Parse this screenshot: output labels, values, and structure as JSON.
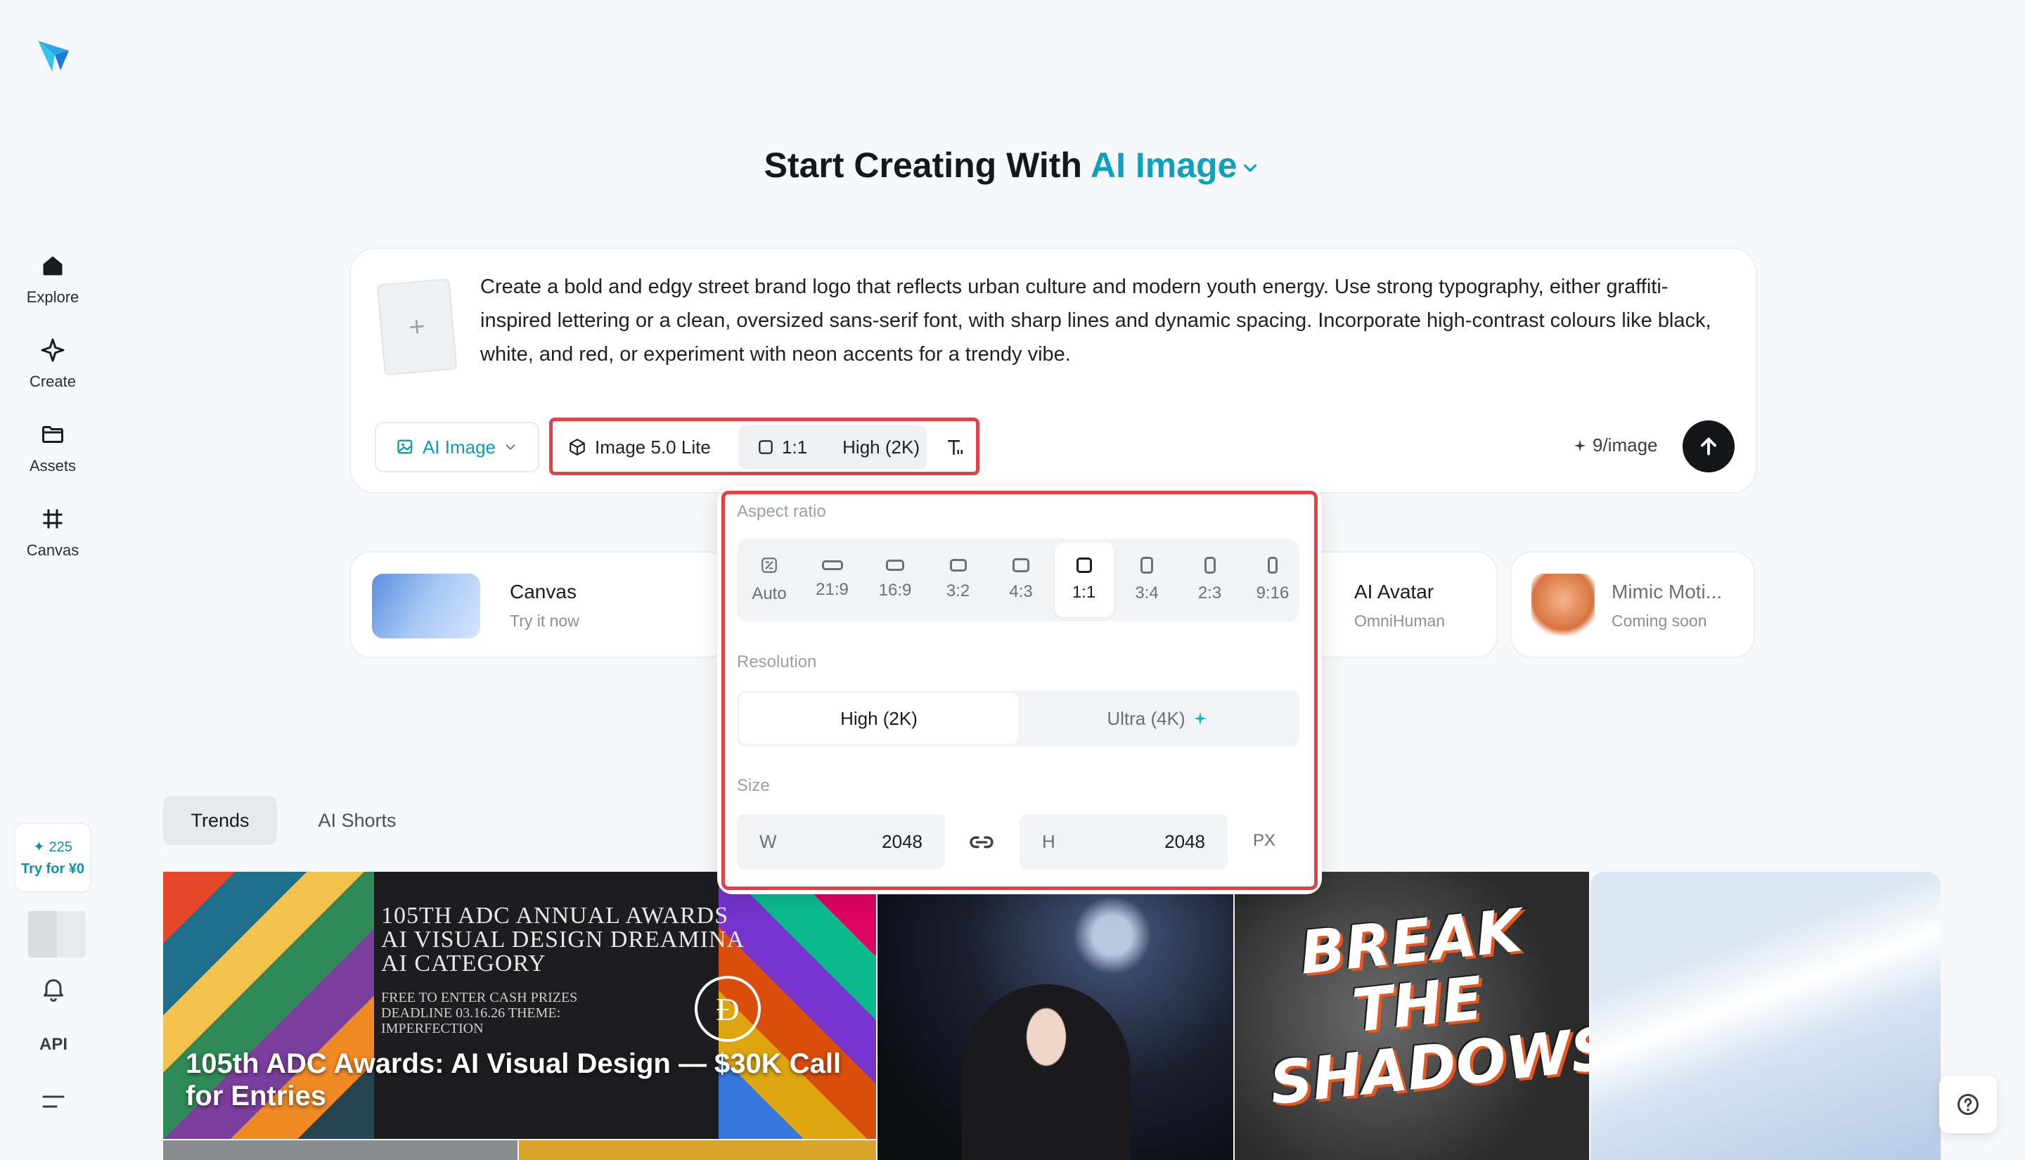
{
  "sidebar": {
    "items": [
      {
        "label": "Explore",
        "icon": "home-icon"
      },
      {
        "label": "Create",
        "icon": "sparkle-outline-icon"
      },
      {
        "label": "Assets",
        "icon": "folder-icon"
      },
      {
        "label": "Canvas",
        "icon": "frame-icon"
      }
    ],
    "credits": {
      "amount": "✦ 225",
      "cta": "Try for ¥0"
    },
    "api_label": "API"
  },
  "headline": {
    "prefix": "Start Creating With ",
    "mode": "AI Image"
  },
  "prompt": {
    "text": "Create a bold and edgy street brand logo that reflects urban culture and modern youth energy. Use strong typography, either graffiti-inspired lettering or a clean, oversized sans-serif font, with sharp lines and dynamic spacing. Incorporate high-contrast colours like black, white, and red, or experiment with neon accents for a trendy vibe.",
    "add_symbol": "+"
  },
  "toolbar": {
    "mode_label": "AI Image",
    "model_label": "Image 5.0 Lite",
    "ratio_label": "1:1",
    "resolution_label": "High (2K)",
    "price_label": "9/image"
  },
  "features": [
    {
      "title": "Canvas",
      "subtitle": "Try it now"
    },
    {
      "title": "AI Avatar",
      "subtitle": "OmniHuman"
    },
    {
      "title": "Mimic Moti...",
      "subtitle": "Coming soon"
    }
  ],
  "popup": {
    "aspect_label": "Aspect ratio",
    "ratios": [
      "Auto",
      "21:9",
      "16:9",
      "3:2",
      "4:3",
      "1:1",
      "3:4",
      "2:3",
      "9:16"
    ],
    "selected_ratio": "1:1",
    "resolution_label": "Resolution",
    "resolutions": [
      "High (2K)",
      "Ultra (4K)"
    ],
    "selected_resolution": "High (2K)",
    "size_label": "Size",
    "width_key": "W",
    "width_value": "2048",
    "height_key": "H",
    "height_value": "2048",
    "unit": "PX"
  },
  "tabs": [
    "Trends",
    "AI Shorts"
  ],
  "gallery": {
    "tile1_heading": "105TH ADC ANNUAL AWARDS AI VISUAL DESIGN DREAMINA AI CATEGORY",
    "tile1_small": "FREE TO ENTER CASH PRIZES DEADLINE 03.16.26 THEME: IMPERFECTION",
    "tile1_caption": "105th ADC Awards: AI Visual Design — $30K Call for Entries",
    "tile1_logo": "Ð",
    "tile3_text": "BREAK THE SHADOWS"
  },
  "colors": {
    "accent": "#0fa0bd",
    "highlight": "#e04347",
    "send": "#141518"
  }
}
